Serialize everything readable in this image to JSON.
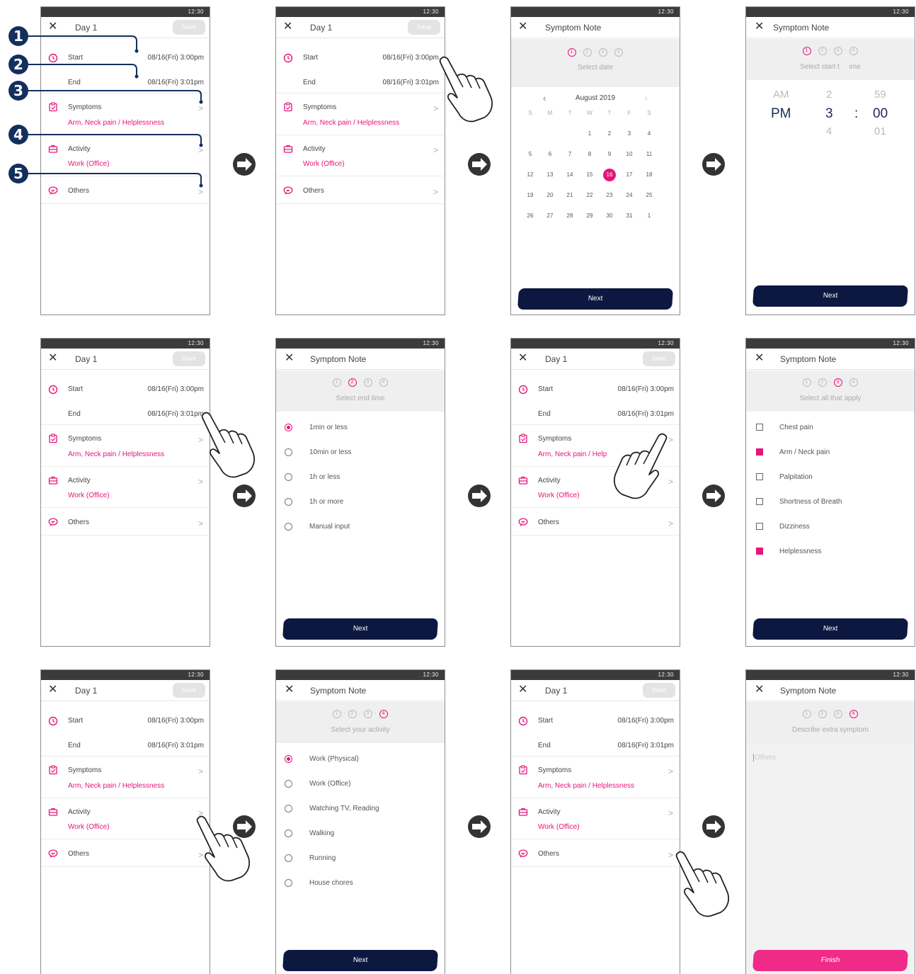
{
  "colors": {
    "accent": "#e6157a",
    "button": "#0c1840",
    "marker": "#132f5e",
    "finish": "#f02a87"
  },
  "status_time": "12:30",
  "markers": [
    "1",
    "2",
    "3",
    "4",
    "5"
  ],
  "day_screen": {
    "close_icon": "close-icon",
    "title": "Day 1",
    "save": "Save",
    "start_label": "Start",
    "start_value": "08/16(Fri) 3:00pm",
    "end_label": "End",
    "end_value": "08/16(Fri) 3:01pm",
    "symptoms_label": "Symptoms",
    "symptoms_value": "Arm, Neck pain / Helplessness",
    "symptoms_value_cut": "Arm, Neck pain / Help",
    "activity_label": "Activity",
    "activity_value": "Work (Office)",
    "others_label": "Others",
    "chevron": ">"
  },
  "note_title": "Symptom Note",
  "steps": [
    "1",
    "2",
    "3",
    "4"
  ],
  "select_date": {
    "hint": "Select date",
    "month": "August 2019",
    "weekdays": [
      "S",
      "M",
      "T",
      "W",
      "T",
      "F",
      "S"
    ],
    "weeks": [
      [
        "",
        "",
        "",
        "1",
        "2",
        "3",
        "4"
      ],
      [
        "5",
        "6",
        "7",
        "8",
        "9",
        "10",
        "11"
      ],
      [
        "12",
        "13",
        "14",
        "15",
        "16",
        "17",
        "18"
      ],
      [
        "19",
        "20",
        "21",
        "22",
        "23",
        "24",
        "25"
      ],
      [
        "26",
        "27",
        "28",
        "29",
        "30",
        "31",
        "1"
      ]
    ],
    "selected": "16",
    "next": "Next"
  },
  "select_start_time": {
    "hint": "Select start t     ime",
    "ampm": [
      "AM",
      "PM"
    ],
    "hours": [
      "2",
      "3",
      "4"
    ],
    "minutes": [
      "59",
      "00",
      "01"
    ],
    "colon": ":",
    "next": "Next"
  },
  "select_end_time": {
    "hint": "Select end time",
    "options": [
      "1min or less",
      "10min or less",
      "1h or less",
      "1h or more",
      "Manual input"
    ],
    "next": "Next"
  },
  "select_symptoms": {
    "hint": "Select all that apply",
    "options": [
      "Chest pain",
      "Arm / Neck pain",
      "Palpitation",
      "Shortness of Breath",
      "Dizziness",
      "Helplessness"
    ],
    "next": "Next"
  },
  "select_activity": {
    "hint": "Select your activity",
    "options": [
      "Work (Physical)",
      "Work (Office)",
      "Watching TV, Reading",
      "Walking",
      "Running",
      "House chores"
    ],
    "next": "Next"
  },
  "describe_extra": {
    "hint": "Describe extra symptom",
    "placeholder": "Others",
    "finish": "Finish"
  }
}
